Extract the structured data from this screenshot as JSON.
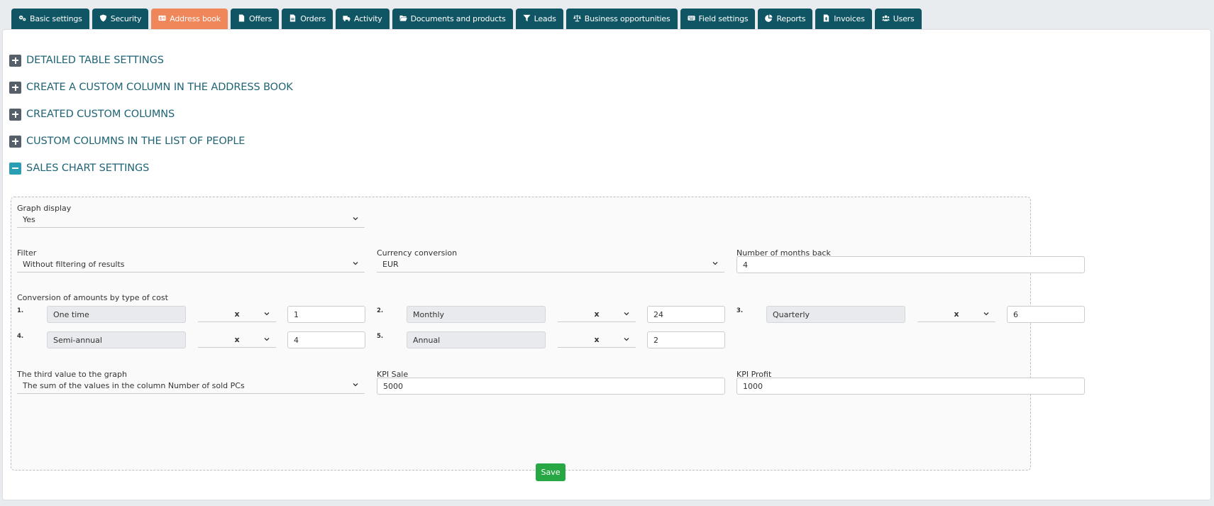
{
  "tabs": [
    {
      "label": "Basic settings",
      "icon": "gears-icon"
    },
    {
      "label": "Security",
      "icon": "shield-icon"
    },
    {
      "label": "Address book",
      "icon": "address-card-icon",
      "active": true
    },
    {
      "label": "Offers",
      "icon": "file-icon"
    },
    {
      "label": "Orders",
      "icon": "file-invoice-icon"
    },
    {
      "label": "Activity",
      "icon": "truck-icon"
    },
    {
      "label": "Documents and products",
      "icon": "folder-open-icon"
    },
    {
      "label": "Leads",
      "icon": "funnel-icon"
    },
    {
      "label": "Business opportunities",
      "icon": "balance-scale-icon"
    },
    {
      "label": "Field settings",
      "icon": "keyboard-icon"
    },
    {
      "label": "Reports",
      "icon": "chart-pie-icon"
    },
    {
      "label": "Invoices",
      "icon": "file-dollar-icon"
    },
    {
      "label": "Users",
      "icon": "users-icon"
    }
  ],
  "sections": [
    {
      "label": "DETAILED TABLE SETTINGS",
      "expanded": false
    },
    {
      "label": "CREATE A CUSTOM COLUMN IN THE ADDRESS BOOK",
      "expanded": false
    },
    {
      "label": "CREATED CUSTOM COLUMNS",
      "expanded": false
    },
    {
      "label": "CUSTOM COLUMNS IN THE LIST OF PEOPLE",
      "expanded": false
    },
    {
      "label": "SALES CHART SETTINGS",
      "expanded": true
    }
  ],
  "form": {
    "graph_display": {
      "label": "Graph display",
      "value": "Yes"
    },
    "filter": {
      "label": "Filter",
      "value": "Without filtering of results"
    },
    "currency": {
      "label": "Currency conversion",
      "value": "EUR"
    },
    "months_back": {
      "label": "Number of months back",
      "value": "4"
    },
    "conversion_label": "Conversion of amounts by type of cost",
    "conversions": [
      {
        "num": "1.",
        "type": "One time",
        "op": "x",
        "value": "1"
      },
      {
        "num": "2.",
        "type": "Monthly",
        "op": "x",
        "value": "24"
      },
      {
        "num": "3.",
        "type": "Quarterly",
        "op": "x",
        "value": "6"
      },
      {
        "num": "4.",
        "type": "Semi-annual",
        "op": "x",
        "value": "4"
      },
      {
        "num": "5.",
        "type": "Annual",
        "op": "x",
        "value": "2"
      }
    ],
    "third_value": {
      "label": "The third value to the graph",
      "value": "The sum of the values in the column Number of sold PCs"
    },
    "kpi_sale": {
      "label": "KPI Sale",
      "value": "5000"
    },
    "kpi_profit": {
      "label": "KPI Profit",
      "value": "1000"
    },
    "save_label": "Save"
  },
  "colors": {
    "tab": "#0f5563",
    "tab_active": "#f0875a",
    "heading": "#1f6475",
    "save": "#28a745"
  }
}
